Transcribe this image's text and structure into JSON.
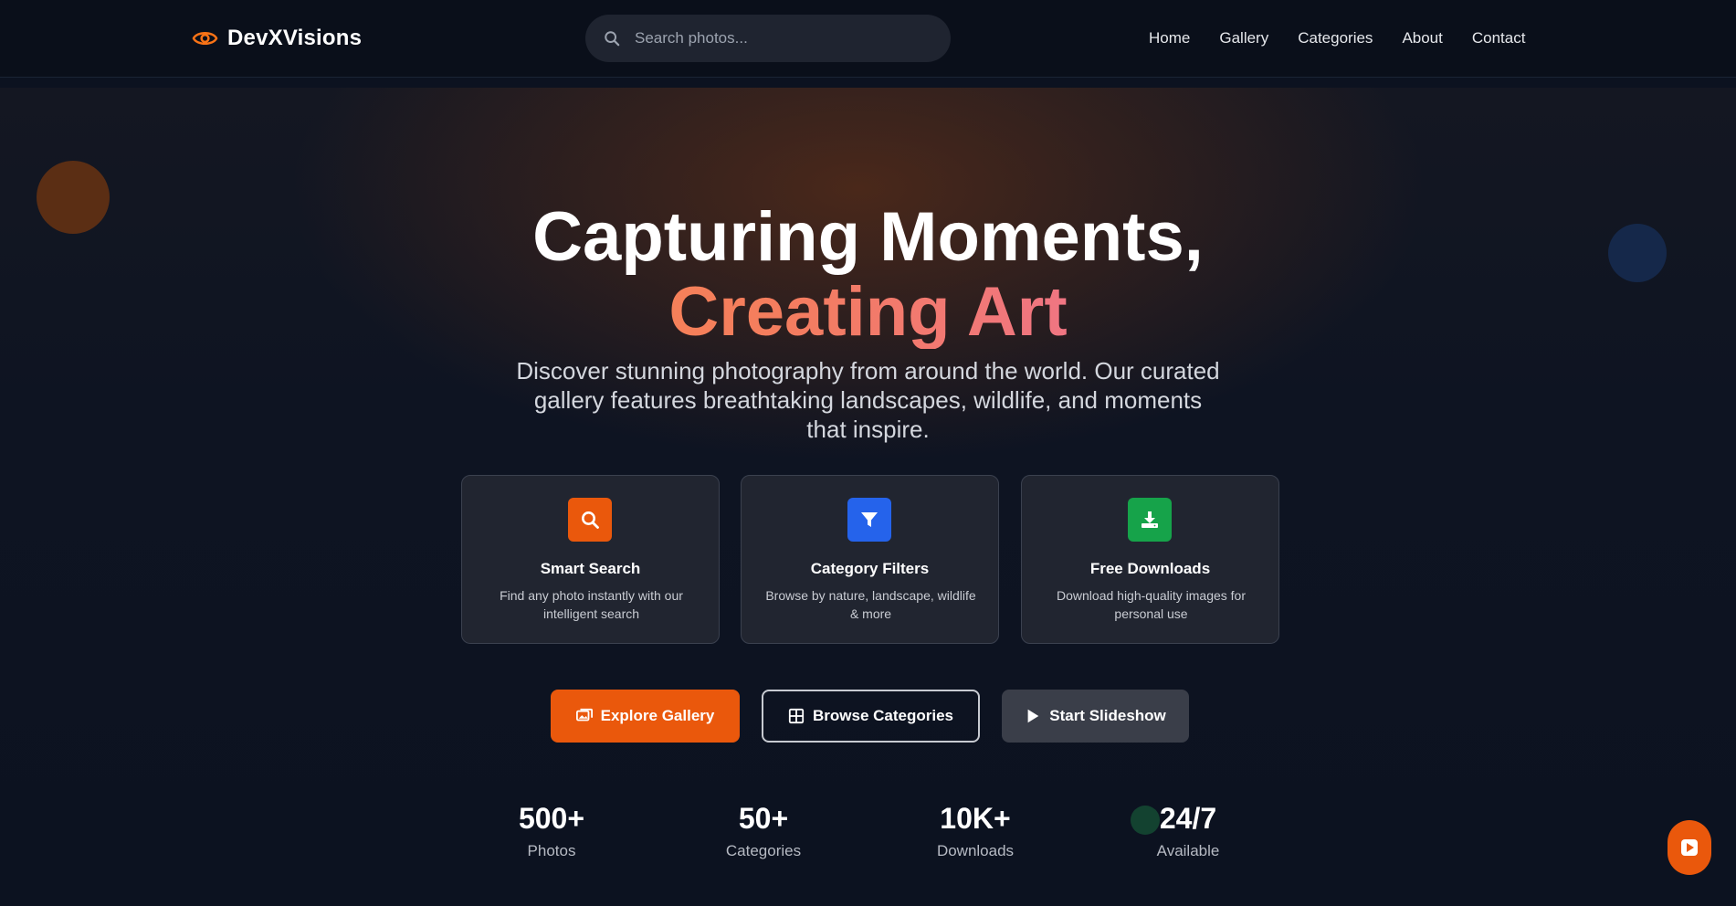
{
  "header": {
    "brand": "DevXVisions",
    "brand_icon": "eye-icon",
    "search": {
      "placeholder": "Search photos...",
      "value": "",
      "icon": "search-icon"
    },
    "nav": [
      "Home",
      "Gallery",
      "Categories",
      "About",
      "Contact"
    ]
  },
  "hero": {
    "title_line1": "Capturing Moments,",
    "title_line2": "Creating Art",
    "subtitle": "Discover stunning photography from around the world. Our curated gallery features breathtaking landscapes, wildlife, and moments that inspire."
  },
  "features": [
    {
      "icon": "search-icon",
      "color": "#ea580c",
      "title": "Smart Search",
      "desc": "Find any photo instantly with our intelligent search"
    },
    {
      "icon": "filter-icon",
      "color": "#2563eb",
      "title": "Category Filters",
      "desc": "Browse by nature, landscape, wildlife & more"
    },
    {
      "icon": "download-icon",
      "color": "#16a34a",
      "title": "Free Downloads",
      "desc": "Download high-quality images for personal use"
    }
  ],
  "buttons": {
    "explore": {
      "label": "Explore Gallery",
      "icon": "images-icon"
    },
    "browse": {
      "label": "Browse Categories",
      "icon": "grid-icon"
    },
    "slideshow": {
      "label": "Start Slideshow",
      "icon": "play-icon"
    }
  },
  "stats": [
    {
      "value": "500+",
      "label": "Photos"
    },
    {
      "value": "50+",
      "label": "Categories"
    },
    {
      "value": "10K+",
      "label": "Downloads"
    },
    {
      "value": "24/7",
      "label": "Available"
    }
  ],
  "colors": {
    "accent": "#ea580c",
    "background": "#0c1220",
    "gradient_from": "#fb923c",
    "gradient_to": "#f472b6"
  },
  "floating_button_icon": "play-icon"
}
